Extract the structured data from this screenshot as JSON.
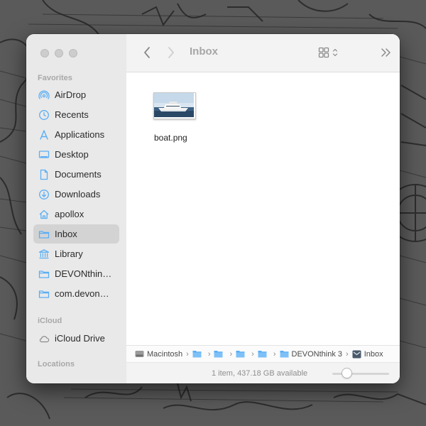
{
  "window": {
    "title": "Inbox"
  },
  "sidebar": {
    "favorites_heading": "Favorites",
    "icloud_heading": "iCloud",
    "locations_heading": "Locations",
    "favorites": [
      {
        "label": "AirDrop",
        "icon": "airdrop-icon"
      },
      {
        "label": "Recents",
        "icon": "clock-icon"
      },
      {
        "label": "Applications",
        "icon": "applications-icon"
      },
      {
        "label": "Desktop",
        "icon": "desktop-icon"
      },
      {
        "label": "Documents",
        "icon": "document-icon"
      },
      {
        "label": "Downloads",
        "icon": "download-icon"
      },
      {
        "label": "apollox",
        "icon": "home-icon"
      },
      {
        "label": "Inbox",
        "icon": "folder-icon",
        "selected": true
      },
      {
        "label": "Library",
        "icon": "library-icon"
      },
      {
        "label": "DEVONthin…",
        "icon": "folder-icon"
      },
      {
        "label": "com.devon…",
        "icon": "folder-icon"
      }
    ],
    "icloud": [
      {
        "label": "iCloud Drive",
        "icon": "cloud-icon"
      }
    ]
  },
  "files": [
    {
      "name": "boat.png",
      "icon": "image-thumbnail-icon"
    }
  ],
  "pathbar": {
    "items": [
      {
        "label": "Macintosh",
        "icon": "hard-drive-icon"
      },
      {
        "label": "",
        "icon": "folder-icon"
      },
      {
        "label": "",
        "icon": "folder-icon"
      },
      {
        "label": "",
        "icon": "folder-icon"
      },
      {
        "label": "",
        "icon": "folder-icon"
      },
      {
        "label": "DEVONthink 3",
        "icon": "folder-icon"
      },
      {
        "label": "Inbox",
        "icon": "inbox-icon"
      }
    ]
  },
  "status": {
    "text": "1 item, 437.18 GB available"
  },
  "icon_size_slider": {
    "value": 0.25
  },
  "colors": {
    "accent": "#5aaef5",
    "sidebar_bg": "#e9e9e9",
    "selected_bg": "#d3d3d3"
  }
}
